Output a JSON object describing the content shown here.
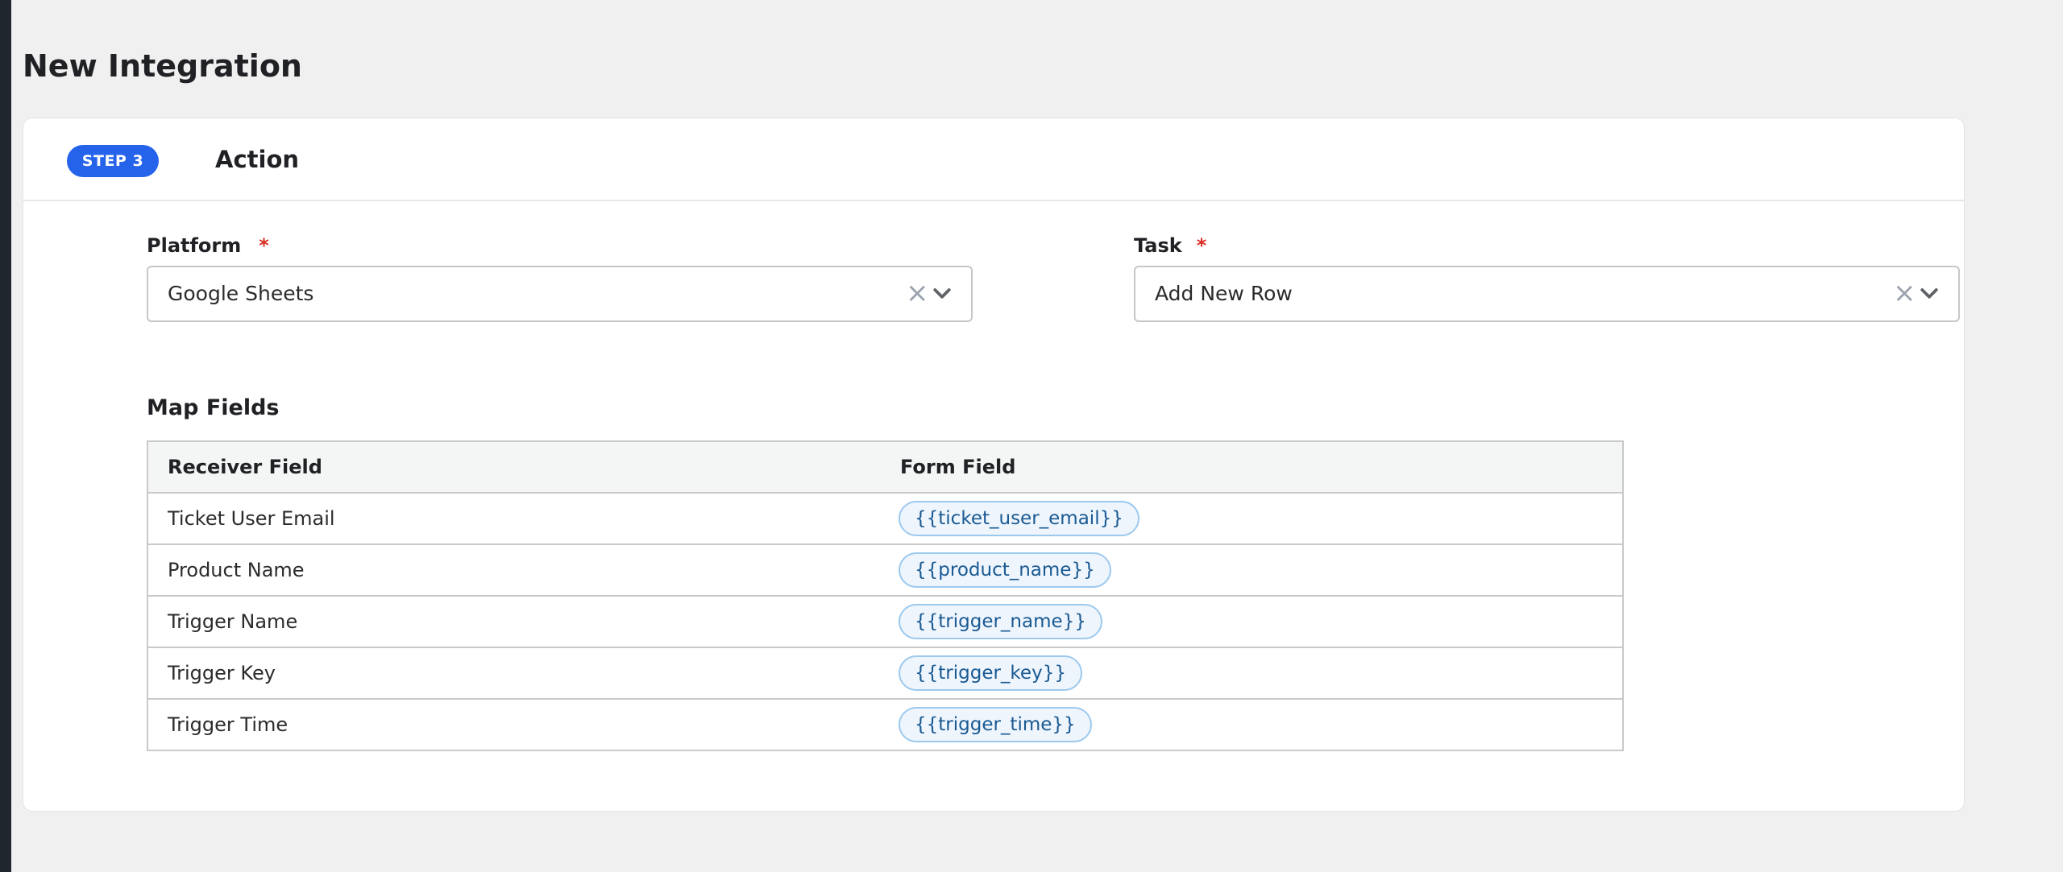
{
  "page": {
    "title": "New Integration"
  },
  "step": {
    "badge": "STEP 3",
    "title": "Action"
  },
  "platform": {
    "label": "Platform",
    "required_mark": "*",
    "value": "Google Sheets",
    "clear_icon": "close-icon",
    "toggle_icon": "chevron-down-icon"
  },
  "task": {
    "label": "Task",
    "required_mark": "*",
    "value": "Add New Row",
    "clear_icon": "close-icon",
    "toggle_icon": "chevron-down-icon"
  },
  "map_fields": {
    "title": "Map Fields",
    "columns": [
      "Receiver Field",
      "Form Field"
    ],
    "rows": [
      {
        "receiver": "Ticket User Email",
        "form_field": "{{ticket_user_email}}"
      },
      {
        "receiver": "Product Name",
        "form_field": "{{product_name}}"
      },
      {
        "receiver": "Trigger Name",
        "form_field": "{{trigger_name}}"
      },
      {
        "receiver": "Trigger Key",
        "form_field": "{{trigger_key}}"
      },
      {
        "receiver": "Trigger Time",
        "form_field": "{{trigger_time}}"
      }
    ]
  },
  "colors": {
    "accent": "#2563eb",
    "required": "#d93025",
    "pill_border": "#9cc9ee",
    "pill_background": "#eef5fd",
    "pill_text": "#1a5a92"
  }
}
